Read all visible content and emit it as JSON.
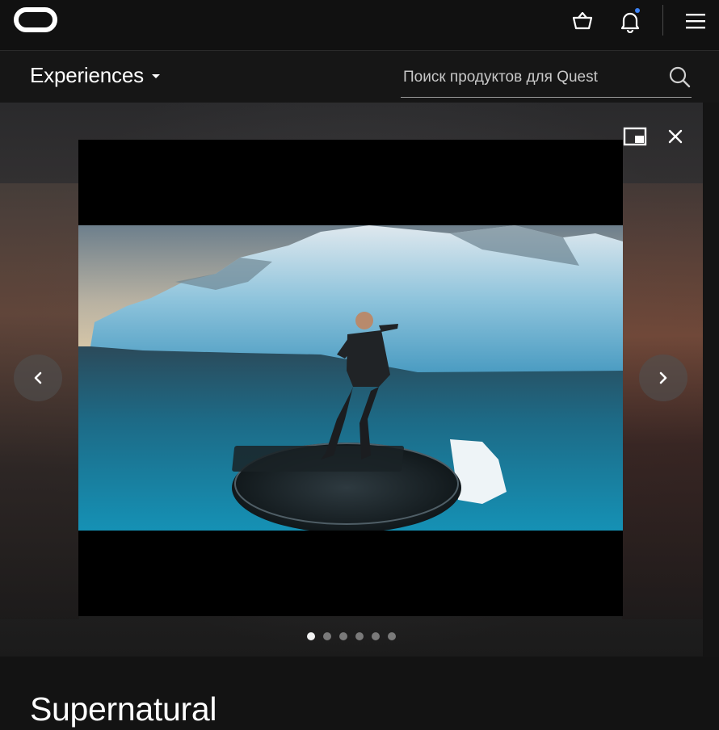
{
  "topbar": {
    "logo_icon": "oculus-logo-icon",
    "cart_icon": "basket-icon",
    "notifications_icon": "bell-icon",
    "notification_dot_color": "#3b82f6",
    "menu_icon": "hamburger-menu-icon"
  },
  "subnav": {
    "section_label": "Experiences",
    "search": {
      "placeholder": "Поиск продуктов для Quest",
      "value": ""
    }
  },
  "hero": {
    "player_controls": {
      "pip_icon": "picture-in-picture-icon",
      "close_icon": "close-icon"
    },
    "prev_icon": "chevron-left-icon",
    "next_icon": "chevron-right-icon",
    "carousel": {
      "total": 6,
      "active_index": 0
    }
  },
  "product": {
    "title": "Supernatural"
  },
  "colors": {
    "background": "#131313",
    "topbar": "#111111",
    "accent_dot": "#3b82f6"
  }
}
